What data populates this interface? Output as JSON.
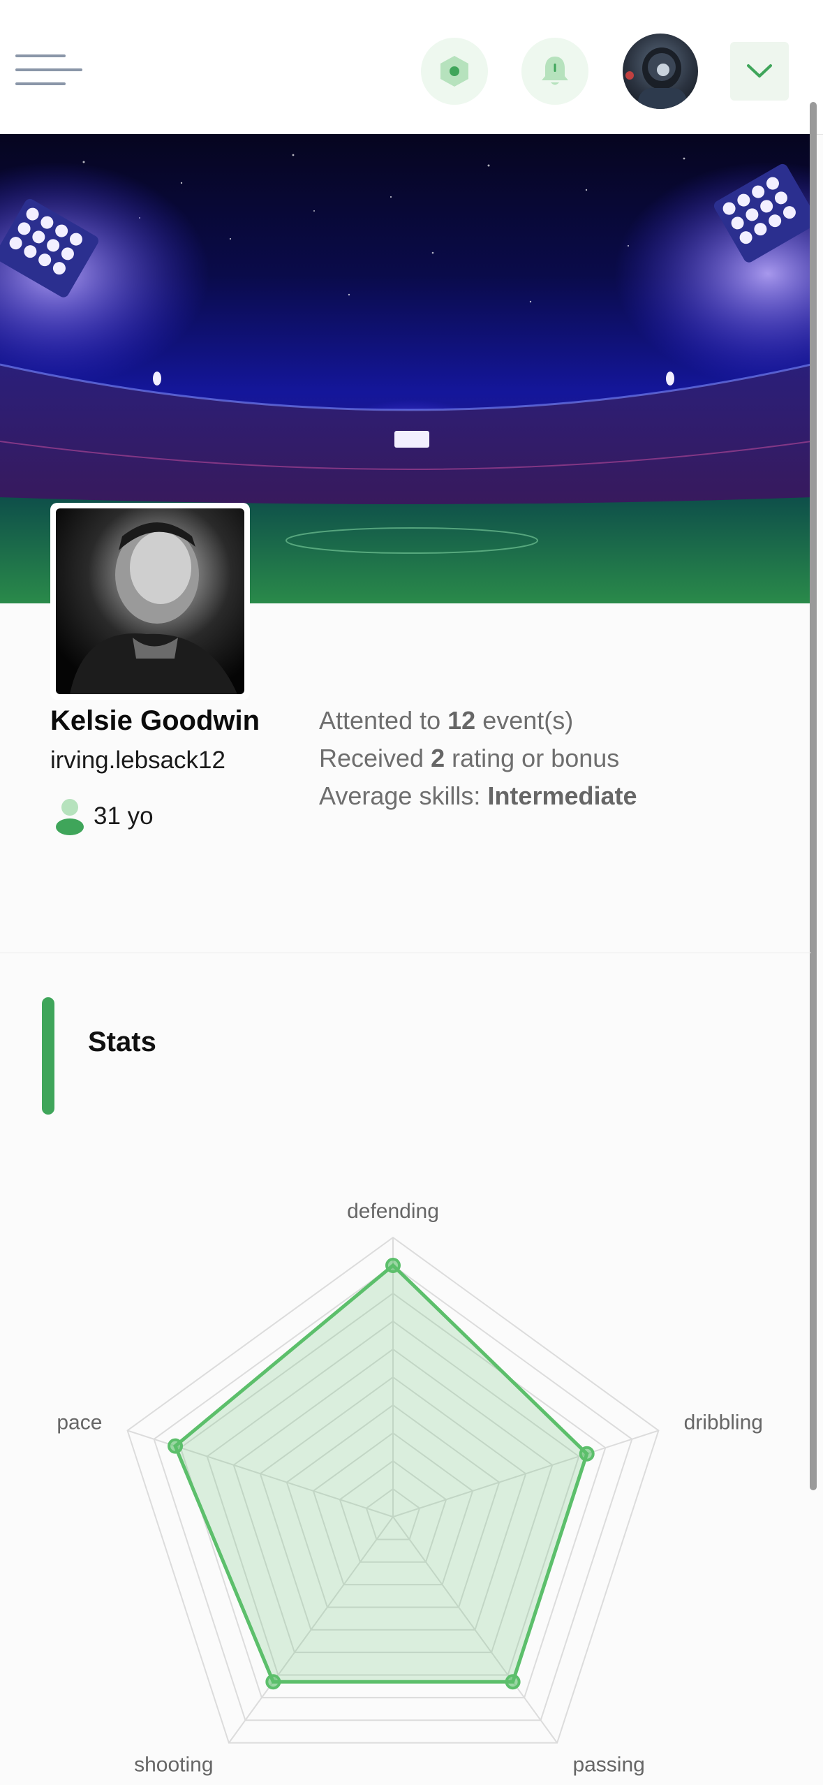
{
  "header": {
    "menu_icon": "hamburger-icon",
    "action_icons": [
      "hexagon-icon",
      "bell-icon",
      "chevron-down-icon"
    ],
    "accent_color": "#3fa55a"
  },
  "profile": {
    "name": "Kelsie Goodwin",
    "username": "irving.lebsack12",
    "age": "31 yo",
    "attended_prefix": "Attented to ",
    "attended_count": "12",
    "attended_suffix": " event(s)",
    "received_prefix": "Received ",
    "received_count": "2",
    "received_suffix": " rating or bonus",
    "skills_prefix": "Average skills: ",
    "skills_value": "Intermediate"
  },
  "stats": {
    "title": "Stats"
  },
  "chart_data": {
    "type": "radar",
    "axes": [
      "defending",
      "dribbling",
      "passing",
      "shooting",
      "pace"
    ],
    "values": [
      90,
      73,
      73,
      73,
      82
    ],
    "range": [
      0,
      100
    ],
    "rings": 10,
    "color": "#5cbf6b"
  }
}
